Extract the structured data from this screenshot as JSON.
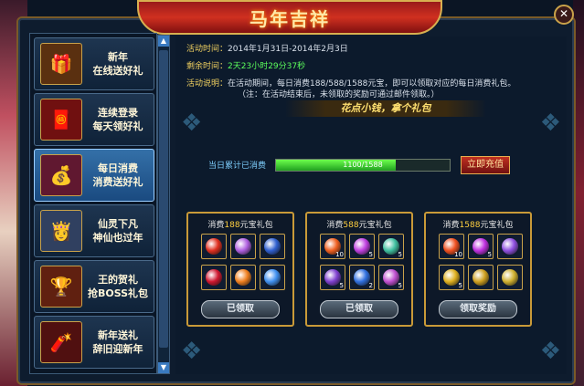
{
  "window": {
    "title": "马年吉祥",
    "close_icon": "close-icon"
  },
  "sidebar": {
    "items": [
      {
        "line1": "新年",
        "line2": "在线送好礼",
        "icon": "gift-bag-icon",
        "glyph": "🎁",
        "active": false
      },
      {
        "line1": "连续登录",
        "line2": "每天领好礼",
        "icon": "red-envelope-icon",
        "glyph": "🧧",
        "active": false
      },
      {
        "line1": "每日消费",
        "line2": "消费送好礼",
        "icon": "gold-ingot-icon",
        "glyph": "💰",
        "active": true
      },
      {
        "line1": "仙灵下凡",
        "line2": "神仙也过年",
        "icon": "fairy-icon",
        "glyph": "👸",
        "active": false
      },
      {
        "line1": "王的贺礼",
        "line2": "抢BOSS礼包",
        "icon": "treasure-chest-icon",
        "glyph": "🏆",
        "active": false
      },
      {
        "line1": "新年送礼",
        "line2": "辞旧迎新年",
        "icon": "firecracker-icon",
        "glyph": "🧨",
        "active": false
      }
    ]
  },
  "activity": {
    "time_label": "活动时间：",
    "time_value": "2014年1月31日-2014年2月3日",
    "remain_label": "剩余时间：",
    "remain_value": "2天23小时29分37秒",
    "desc_label": "活动说明：",
    "desc_line1": "在活动期间，每日消费188/588/1588元宝，即可以领取对应的每日消费礼包。",
    "desc_line2": "（注：在活动结束后，未领取的奖励可通过邮件领取。）",
    "slogan": "花点小钱，拿个礼包"
  },
  "progress": {
    "label": "当日累计已消费",
    "text": "1100/1588",
    "fraction": 0.69,
    "recharge_label": "立即充值"
  },
  "packs": [
    {
      "prefix": "消费",
      "amount": "188",
      "suffix": "元宝礼包",
      "button": "已领取",
      "items": [
        {
          "color": "#e03020",
          "count": ""
        },
        {
          "color": "#b060e0",
          "count": ""
        },
        {
          "color": "#3060d0",
          "count": ""
        },
        {
          "color": "#d01830",
          "count": ""
        },
        {
          "color": "#f08020",
          "count": ""
        },
        {
          "color": "#4090f0",
          "count": ""
        }
      ]
    },
    {
      "prefix": "消费",
      "amount": "588",
      "suffix": "元宝礼包",
      "button": "已领取",
      "items": [
        {
          "color": "#f06020",
          "count": "10"
        },
        {
          "color": "#c040e0",
          "count": "5"
        },
        {
          "color": "#40c0a0",
          "count": "5"
        },
        {
          "color": "#8040d0",
          "count": "5"
        },
        {
          "color": "#3070e0",
          "count": "2"
        },
        {
          "color": "#c050d0",
          "count": "5"
        }
      ]
    },
    {
      "prefix": "消费",
      "amount": "1588",
      "suffix": "元宝礼包",
      "button": "领取奖励",
      "items": [
        {
          "color": "#f05020",
          "count": "10"
        },
        {
          "color": "#c030e0",
          "count": "5"
        },
        {
          "color": "#9050e0",
          "count": ""
        },
        {
          "color": "#e0b020",
          "count": "5"
        },
        {
          "color": "#d0a020",
          "count": ""
        },
        {
          "color": "#d0b030",
          "count": ""
        }
      ]
    }
  ]
}
